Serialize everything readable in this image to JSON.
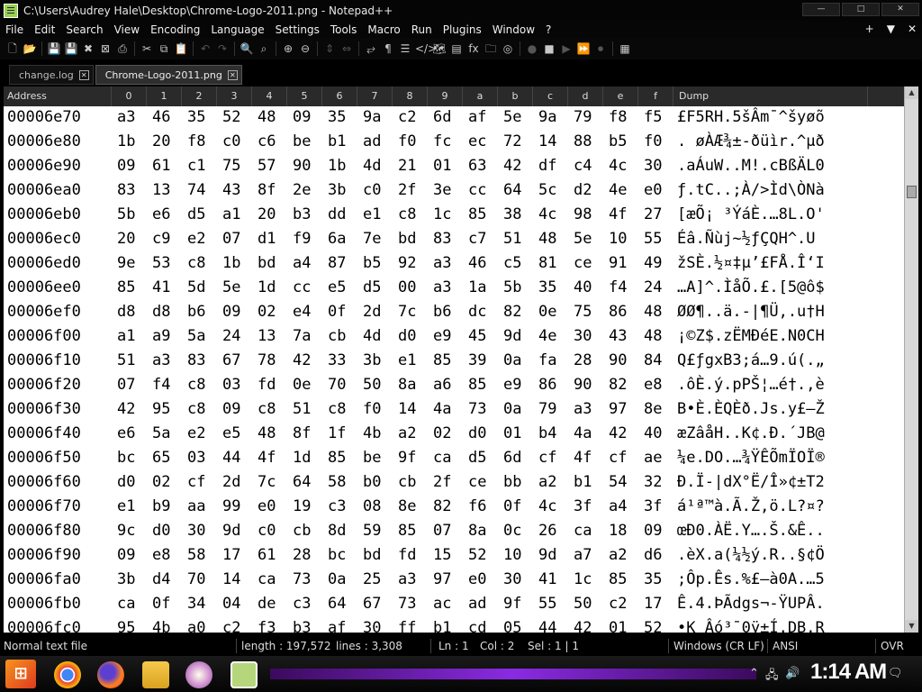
{
  "window": {
    "title": "C:\\Users\\Audrey Hale\\Desktop\\Chrome-Logo-2011.png - Notepad++",
    "controls": [
      "—",
      "□",
      "✕"
    ]
  },
  "menu": {
    "items": [
      "File",
      "Edit",
      "Search",
      "View",
      "Encoding",
      "Language",
      "Settings",
      "Tools",
      "Macro",
      "Run",
      "Plugins",
      "Window",
      "?"
    ],
    "right": [
      "+",
      "▼",
      "✕"
    ]
  },
  "toolbar": {
    "icons": [
      {
        "name": "new-file-icon",
        "glyph": "🗋",
        "enabled": true
      },
      {
        "name": "open-file-icon",
        "glyph": "📂",
        "enabled": true
      },
      {
        "name": "save-icon",
        "glyph": "💾",
        "enabled": false
      },
      {
        "name": "save-all-icon",
        "glyph": "💾",
        "enabled": false
      },
      {
        "name": "close-icon",
        "glyph": "✖",
        "enabled": true
      },
      {
        "name": "close-all-icon",
        "glyph": "⊠",
        "enabled": true
      },
      {
        "name": "print-icon",
        "glyph": "⎙",
        "enabled": true
      },
      {
        "name": "cut-icon",
        "glyph": "✂",
        "enabled": true
      },
      {
        "name": "copy-icon",
        "glyph": "⧉",
        "enabled": true
      },
      {
        "name": "paste-icon",
        "glyph": "📋",
        "enabled": true
      },
      {
        "name": "undo-icon",
        "glyph": "↶",
        "enabled": false
      },
      {
        "name": "redo-icon",
        "glyph": "↷",
        "enabled": false
      },
      {
        "name": "find-icon",
        "glyph": "🔍",
        "enabled": true
      },
      {
        "name": "replace-icon",
        "glyph": "⌕",
        "enabled": true
      },
      {
        "name": "zoom-in-icon",
        "glyph": "⊕",
        "enabled": true
      },
      {
        "name": "zoom-out-icon",
        "glyph": "⊖",
        "enabled": true
      },
      {
        "name": "sync-vertical-icon",
        "glyph": "⇕",
        "enabled": false
      },
      {
        "name": "sync-horizontal-icon",
        "glyph": "⇔",
        "enabled": false
      },
      {
        "name": "word-wrap-icon",
        "glyph": "⥂",
        "enabled": true
      },
      {
        "name": "show-all-chars-icon",
        "glyph": "¶",
        "enabled": true
      },
      {
        "name": "indent-guide-icon",
        "glyph": "☰",
        "enabled": true
      },
      {
        "name": "xml-tags-icon",
        "glyph": "</>",
        "enabled": true
      },
      {
        "name": "document-map-icon",
        "glyph": "🗺",
        "enabled": true
      },
      {
        "name": "document-list-icon",
        "glyph": "▤",
        "enabled": true
      },
      {
        "name": "function-list-icon",
        "glyph": "fx",
        "enabled": true
      },
      {
        "name": "folder-workspace-icon",
        "glyph": "🗀",
        "enabled": true
      },
      {
        "name": "monitoring-icon",
        "glyph": "◎",
        "enabled": true
      },
      {
        "name": "record-macro-icon",
        "glyph": "●",
        "enabled": false
      },
      {
        "name": "stop-record-icon",
        "glyph": "■",
        "enabled": true
      },
      {
        "name": "play-macro-icon",
        "glyph": "▶",
        "enabled": false
      },
      {
        "name": "run-macro-multiple-icon",
        "glyph": "⏩",
        "enabled": true
      },
      {
        "name": "save-macro-icon",
        "glyph": "⏺",
        "enabled": false
      },
      {
        "name": "hex-editor-icon",
        "glyph": "▦",
        "enabled": true
      }
    ]
  },
  "tabs": [
    {
      "label": "change.log",
      "active": false
    },
    {
      "label": "Chrome-Logo-2011.png",
      "active": true
    }
  ],
  "hex": {
    "columns": [
      "Address",
      "0",
      "1",
      "2",
      "3",
      "4",
      "5",
      "6",
      "7",
      "8",
      "9",
      "a",
      "b",
      "c",
      "d",
      "e",
      "f",
      "Dump"
    ],
    "rows": [
      {
        "addr": "00006e70",
        "bytes": [
          "a3",
          "46",
          "35",
          "52",
          "48",
          "09",
          "35",
          "9a",
          "c2",
          "6d",
          "af",
          "5e",
          "9a",
          "79",
          "f8",
          "f5"
        ],
        "dump": "£F5RH.5šÂm¯^šyøõ"
      },
      {
        "addr": "00006e80",
        "bytes": [
          "1b",
          "20",
          "f8",
          "c0",
          "c6",
          "be",
          "b1",
          "ad",
          "f0",
          "fc",
          "ec",
          "72",
          "14",
          "88",
          "b5",
          "f0"
        ],
        "dump": ". øÀÆ¾±-ðüìr.^µð"
      },
      {
        "addr": "00006e90",
        "bytes": [
          "09",
          "61",
          "c1",
          "75",
          "57",
          "90",
          "1b",
          "4d",
          "21",
          "01",
          "63",
          "42",
          "df",
          "c4",
          "4c",
          "30"
        ],
        "dump": ".aÁuW..M!.cBßÄL0"
      },
      {
        "addr": "00006ea0",
        "bytes": [
          "83",
          "13",
          "74",
          "43",
          "8f",
          "2e",
          "3b",
          "c0",
          "2f",
          "3e",
          "cc",
          "64",
          "5c",
          "d2",
          "4e",
          "e0"
        ],
        "dump": "ƒ.tC..;À/>Ìd\\ÒNà"
      },
      {
        "addr": "00006eb0",
        "bytes": [
          "5b",
          "e6",
          "d5",
          "a1",
          "20",
          "b3",
          "dd",
          "e1",
          "c8",
          "1c",
          "85",
          "38",
          "4c",
          "98",
          "4f",
          "27"
        ],
        "dump": "[æÕ¡ ³ÝáÈ.…8L.O'"
      },
      {
        "addr": "00006ec0",
        "bytes": [
          "20",
          "c9",
          "e2",
          "07",
          "d1",
          "f9",
          "6a",
          "7e",
          "bd",
          "83",
          "c7",
          "51",
          "48",
          "5e",
          "10",
          "55"
        ],
        "dump": " Éâ.Ñùj~½ƒÇQH^.U"
      },
      {
        "addr": "00006ed0",
        "bytes": [
          "9e",
          "53",
          "c8",
          "1b",
          "bd",
          "a4",
          "87",
          "b5",
          "92",
          "a3",
          "46",
          "c5",
          "81",
          "ce",
          "91",
          "49"
        ],
        "dump": "žSÈ.½¤‡µ’£FÅ.Î‘I"
      },
      {
        "addr": "00006ee0",
        "bytes": [
          "85",
          "41",
          "5d",
          "5e",
          "1d",
          "cc",
          "e5",
          "d5",
          "00",
          "a3",
          "1a",
          "5b",
          "35",
          "40",
          "f4",
          "24"
        ],
        "dump": "…A]^.ÌåÕ.£.[5@ô$"
      },
      {
        "addr": "00006ef0",
        "bytes": [
          "d8",
          "d8",
          "b6",
          "09",
          "02",
          "e4",
          "0f",
          "2d",
          "7c",
          "b6",
          "dc",
          "82",
          "0e",
          "75",
          "86",
          "48"
        ],
        "dump": "ØØ¶..ä.-|¶Ü‚.u†H"
      },
      {
        "addr": "00006f00",
        "bytes": [
          "a1",
          "a9",
          "5a",
          "24",
          "13",
          "7a",
          "cb",
          "4d",
          "d0",
          "e9",
          "45",
          "9d",
          "4e",
          "30",
          "43",
          "48"
        ],
        "dump": "¡©Z$.zËMÐéE.N0CH"
      },
      {
        "addr": "00006f10",
        "bytes": [
          "51",
          "a3",
          "83",
          "67",
          "78",
          "42",
          "33",
          "3b",
          "e1",
          "85",
          "39",
          "0a",
          "fa",
          "28",
          "90",
          "84"
        ],
        "dump": "Q£ƒgxB3;á…9.ú(.„"
      },
      {
        "addr": "00006f20",
        "bytes": [
          "07",
          "f4",
          "c8",
          "03",
          "fd",
          "0e",
          "70",
          "50",
          "8a",
          "a6",
          "85",
          "e9",
          "86",
          "90",
          "82",
          "e8"
        ],
        "dump": ".ôÈ.ý.pPŠ¦…é†.‚è"
      },
      {
        "addr": "00006f30",
        "bytes": [
          "42",
          "95",
          "c8",
          "09",
          "c8",
          "51",
          "c8",
          "f0",
          "14",
          "4a",
          "73",
          "0a",
          "79",
          "a3",
          "97",
          "8e"
        ],
        "dump": "B•È.ÈQÈð.Js.y£—Ž"
      },
      {
        "addr": "00006f40",
        "bytes": [
          "e6",
          "5a",
          "e2",
          "e5",
          "48",
          "8f",
          "1f",
          "4b",
          "a2",
          "02",
          "d0",
          "01",
          "b4",
          "4a",
          "42",
          "40"
        ],
        "dump": "æZâåH..K¢.Ð.´JB@"
      },
      {
        "addr": "00006f50",
        "bytes": [
          "bc",
          "65",
          "03",
          "44",
          "4f",
          "1d",
          "85",
          "be",
          "9f",
          "ca",
          "d5",
          "6d",
          "cf",
          "4f",
          "cf",
          "ae"
        ],
        "dump": "¼e.DO.…¾ŸÊÕmÏOÏ®"
      },
      {
        "addr": "00006f60",
        "bytes": [
          "d0",
          "02",
          "cf",
          "2d",
          "7c",
          "64",
          "58",
          "b0",
          "cb",
          "2f",
          "ce",
          "bb",
          "a2",
          "b1",
          "54",
          "32"
        ],
        "dump": "Ð.Ï-|dX°Ë/Î»¢±T2"
      },
      {
        "addr": "00006f70",
        "bytes": [
          "e1",
          "b9",
          "aa",
          "99",
          "e0",
          "19",
          "c3",
          "08",
          "8e",
          "82",
          "f6",
          "0f",
          "4c",
          "3f",
          "a4",
          "3f"
        ],
        "dump": "á¹ª™à.Ã.Ž‚ö.L?¤?"
      },
      {
        "addr": "00006f80",
        "bytes": [
          "9c",
          "d0",
          "30",
          "9d",
          "c0",
          "cb",
          "8d",
          "59",
          "85",
          "07",
          "8a",
          "0c",
          "26",
          "ca",
          "18",
          "09"
        ],
        "dump": "œÐ0.ÀË.Y….Š.&Ê.."
      },
      {
        "addr": "00006f90",
        "bytes": [
          "09",
          "e8",
          "58",
          "17",
          "61",
          "28",
          "bc",
          "bd",
          "fd",
          "15",
          "52",
          "10",
          "9d",
          "a7",
          "a2",
          "d6"
        ],
        "dump": ".èX.a(¼½ý.R..§¢Ö"
      },
      {
        "addr": "00006fa0",
        "bytes": [
          "3b",
          "d4",
          "70",
          "14",
          "ca",
          "73",
          "0a",
          "25",
          "a3",
          "97",
          "e0",
          "30",
          "41",
          "1c",
          "85",
          "35"
        ],
        "dump": ";Ôp.Ês.%£—à0A.…5"
      },
      {
        "addr": "00006fb0",
        "bytes": [
          "ca",
          "0f",
          "34",
          "04",
          "de",
          "c3",
          "64",
          "67",
          "73",
          "ac",
          "ad",
          "9f",
          "55",
          "50",
          "c2",
          "17"
        ],
        "dump": "Ê.4.ÞÃdgs¬-ŸUPÂ."
      },
      {
        "addr": "00006fc0",
        "bytes": [
          "95",
          "4b",
          "a0",
          "c2",
          "f3",
          "b3",
          "af",
          "30",
          "ff",
          "b1",
          "cd",
          "05",
          "44",
          "42",
          "01",
          "52"
        ],
        "dump": "•K Âó³¯0ÿ±Í.DB.R"
      }
    ]
  },
  "status": {
    "file_type": "Normal text file",
    "length": "length : 197,572",
    "lines": "lines : 3,308",
    "ln": "Ln : 1",
    "col": "Col : 2",
    "sel": "Sel : 1 | 1",
    "eol": "Windows (CR LF)",
    "encoding": "ANSI",
    "mode": "OVR"
  },
  "taskbar": {
    "clock": "1:14 AM",
    "apps": [
      "start-button",
      "chrome-icon",
      "firefox-icon",
      "file-explorer-icon",
      "paint-icon",
      "notepad-plus-plus-icon"
    ]
  },
  "scroll": {
    "position_fraction": 0.17
  }
}
